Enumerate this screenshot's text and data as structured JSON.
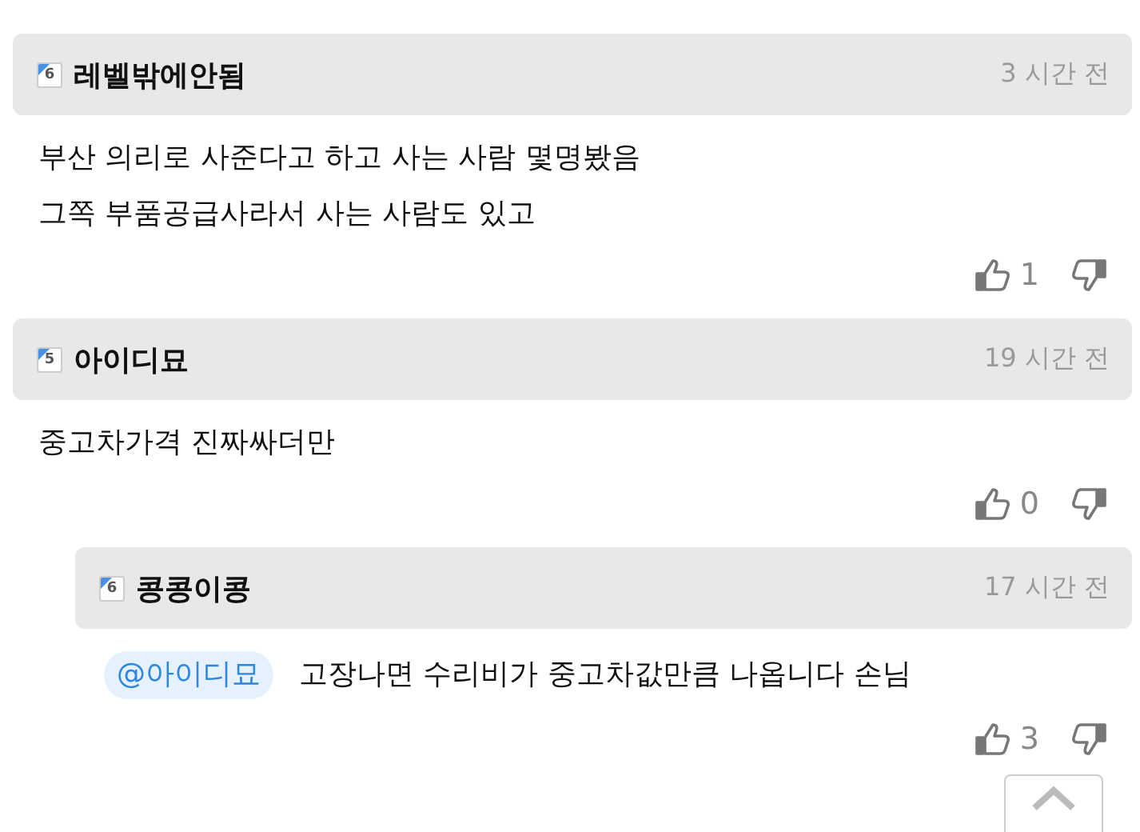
{
  "comments": [
    {
      "kind": "comment",
      "level": "6",
      "author": "레벨밖에안됨",
      "time": "3 시간 전",
      "lines": [
        "부산 의리로 사준다고 하고 사는 사람 몇명봤음",
        "그쪽 부품공급사라서 사는 사람도 있고"
      ],
      "likes": "1"
    },
    {
      "kind": "comment",
      "level": "5",
      "author": "아이디묘",
      "time": "19 시간 전",
      "lines": [
        "중고차가격 진짜싸더만"
      ],
      "likes": "0"
    },
    {
      "kind": "reply",
      "level": "6",
      "author": "콩콩이콩",
      "time": "17 시간 전",
      "mention": "@아이디묘",
      "lines": [
        "고장나면 수리비가 중고차값만큼 나옵니다 손님"
      ],
      "likes": "3"
    }
  ]
}
